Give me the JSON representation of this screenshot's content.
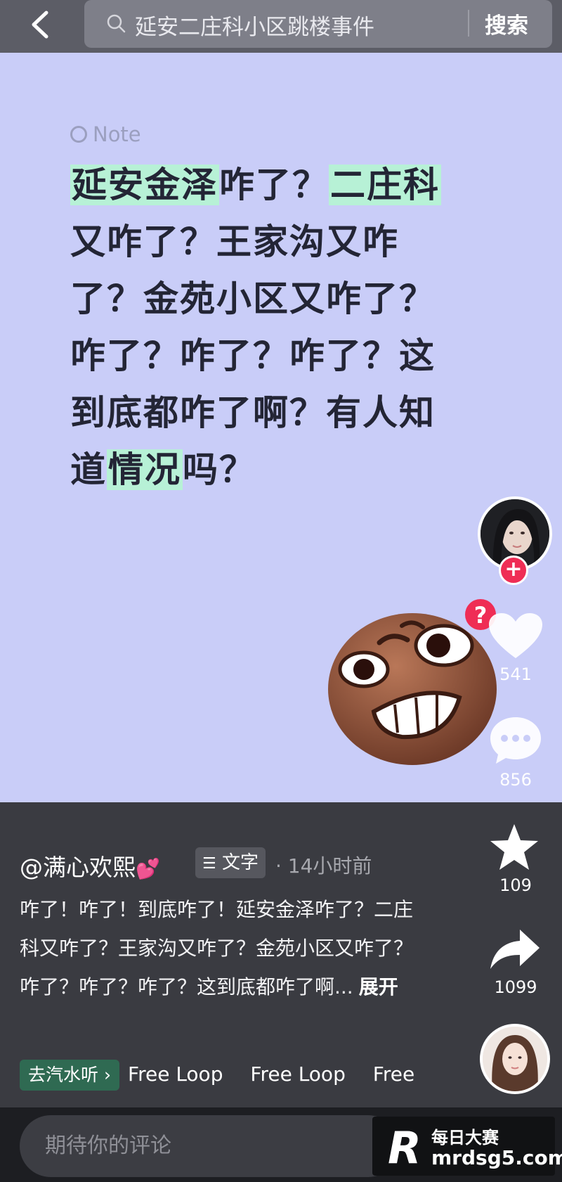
{
  "search": {
    "query": "延安二庄科小区跳楼事件",
    "button_label": "搜索"
  },
  "note": {
    "tag_label": "Note",
    "segments": [
      {
        "text": "延安金泽",
        "highlight": true
      },
      {
        "text": "咋了？",
        "highlight": false
      },
      {
        "text": "二庄科",
        "highlight": true
      },
      {
        "text": "又咋了？王家沟又咋了？金苑小区又咋了？咋了？咋了？咋了？这到底都咋了啊？有人知道",
        "highlight": false
      },
      {
        "text": "情况",
        "highlight": true
      },
      {
        "text": "吗？",
        "highlight": false
      }
    ],
    "highlight_color": "#b7f1d6"
  },
  "actions": {
    "like_count": "541",
    "comment_count": "856",
    "favorite_count": "109",
    "share_count": "1099"
  },
  "post": {
    "author": "@满心欢熙",
    "author_emoji": "💕",
    "type_tag": "文字",
    "time": "· 14小时前",
    "description": "咋了！咋了！到底咋了！延安金泽咋了？二庄科又咋了？王家沟又咋了？金苑小区又咋了？咋了？咋了？咋了？这到底都咋了啊...",
    "expand_label": "展开"
  },
  "music": {
    "chip_label": "去汽水听",
    "track_items": [
      "Free Loop",
      "Free Loop",
      "Free L"
    ]
  },
  "comment": {
    "placeholder": "期待你的评论"
  },
  "watermark": {
    "logo": "R",
    "title": "每日大赛",
    "url": "mrdsg5.com"
  },
  "colors": {
    "card_bg": "#c9cdf8",
    "accent_red": "#ef2d55",
    "panel_bg": "#3a3b41"
  }
}
